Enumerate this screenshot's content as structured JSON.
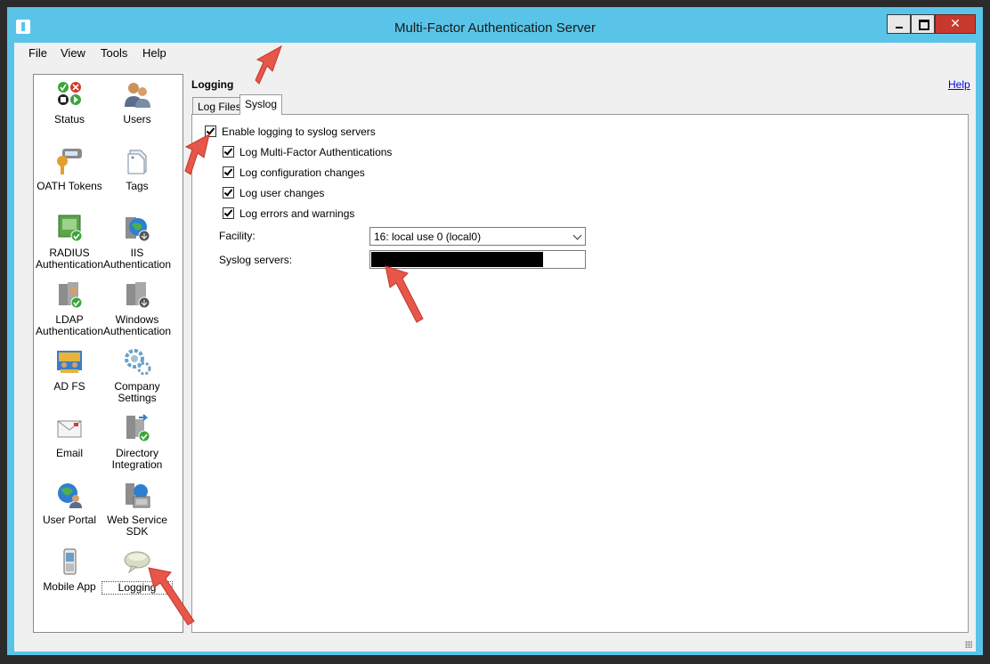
{
  "window": {
    "title": "Multi-Factor Authentication Server",
    "close_glyph": "✕"
  },
  "menu": [
    "File",
    "View",
    "Tools",
    "Help"
  ],
  "nav": [
    {
      "label": "Status",
      "icon": "status-icon"
    },
    {
      "label": "Users",
      "icon": "users-icon"
    },
    {
      "label": "OATH Tokens",
      "icon": "oath-token-icon"
    },
    {
      "label": "Tags",
      "icon": "tags-icon"
    },
    {
      "label": "RADIUS Authentication",
      "icon": "radius-icon"
    },
    {
      "label": "IIS Authentication",
      "icon": "iis-globe-icon"
    },
    {
      "label": "LDAP Authentication",
      "icon": "ldap-server-icon"
    },
    {
      "label": "Windows Authentication",
      "icon": "windows-server-icon"
    },
    {
      "label": "AD FS",
      "icon": "adfs-icon"
    },
    {
      "label": "Company Settings",
      "icon": "gears-icon"
    },
    {
      "label": "Email",
      "icon": "envelope-icon"
    },
    {
      "label": "Directory Integration",
      "icon": "directory-icon"
    },
    {
      "label": "User Portal",
      "icon": "user-globe-icon"
    },
    {
      "label": "Web Service SDK",
      "icon": "sdk-icon"
    },
    {
      "label": "Mobile App",
      "icon": "phone-icon"
    },
    {
      "label": "Logging",
      "icon": "speech-bubble-icon"
    }
  ],
  "main": {
    "section_title": "Logging",
    "help_link": "Help",
    "tabs": [
      {
        "label": "Log Files",
        "active": false
      },
      {
        "label": "Syslog",
        "active": true
      }
    ],
    "enable_logging": {
      "label": "Enable logging to syslog servers",
      "checked": true
    },
    "options": [
      {
        "label": "Log Multi-Factor Authentications",
        "checked": true
      },
      {
        "label": "Log configuration changes",
        "checked": true
      },
      {
        "label": "Log user changes",
        "checked": true
      },
      {
        "label": "Log errors and warnings",
        "checked": true
      }
    ],
    "facility": {
      "label": "Facility:",
      "value": "16: local use 0 (local0)"
    },
    "syslog_servers": {
      "label": "Syslog servers:",
      "value": ""
    }
  },
  "colors": {
    "titlebar": "#5ac4e8",
    "client_bg": "#f0f0f0",
    "annotation_arrow": "#e8564a"
  }
}
